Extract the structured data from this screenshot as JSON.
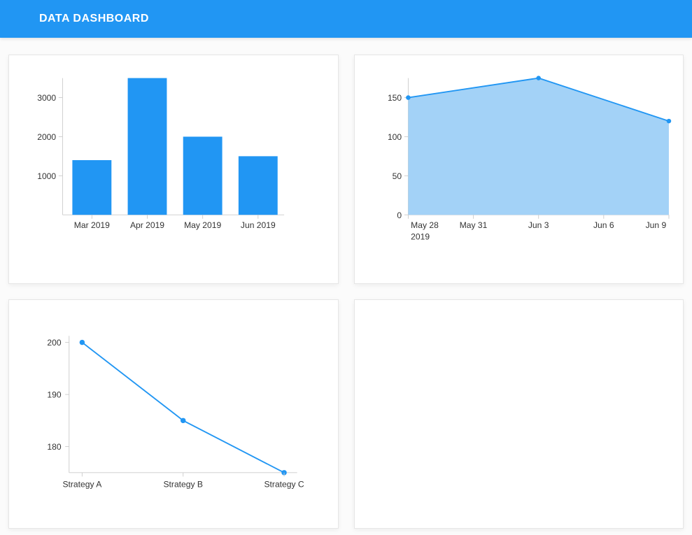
{
  "header": {
    "title": "DATA DASHBOARD"
  },
  "colors": {
    "accent": "#2196f3",
    "fill_light": "#a3d2f7",
    "axis": "#cccccc",
    "text": "#333333"
  },
  "chart_data": [
    {
      "type": "bar",
      "title": "",
      "categories": [
        "Mar 2019",
        "Apr 2019",
        "May 2019",
        "Jun 2019"
      ],
      "values": [
        1400,
        3500,
        2000,
        1500
      ],
      "xlabel": "",
      "ylabel": "",
      "ylim": [
        0,
        3500
      ],
      "y_ticks": [
        1000,
        2000,
        3000
      ]
    },
    {
      "type": "area",
      "title": "",
      "x_ticks": [
        "May 28",
        "May 31",
        "Jun 3",
        "Jun 6",
        "Jun 9"
      ],
      "x_sublabel": "2019",
      "x": [
        "May 28",
        "Jun 3",
        "Jun 9"
      ],
      "values": [
        150,
        175,
        120
      ],
      "xlabel": "",
      "ylabel": "",
      "ylim": [
        0,
        175
      ],
      "y_ticks": [
        0,
        50,
        100,
        150
      ]
    },
    {
      "type": "line",
      "title": "",
      "categories": [
        "Strategy A",
        "Strategy B",
        "Strategy C"
      ],
      "values": [
        200,
        185,
        175
      ],
      "xlabel": "",
      "ylabel": "",
      "ylim": [
        175,
        200
      ],
      "y_ticks": [
        180,
        190,
        200
      ]
    },
    {
      "type": "table",
      "title": "",
      "note": "empty card"
    }
  ]
}
